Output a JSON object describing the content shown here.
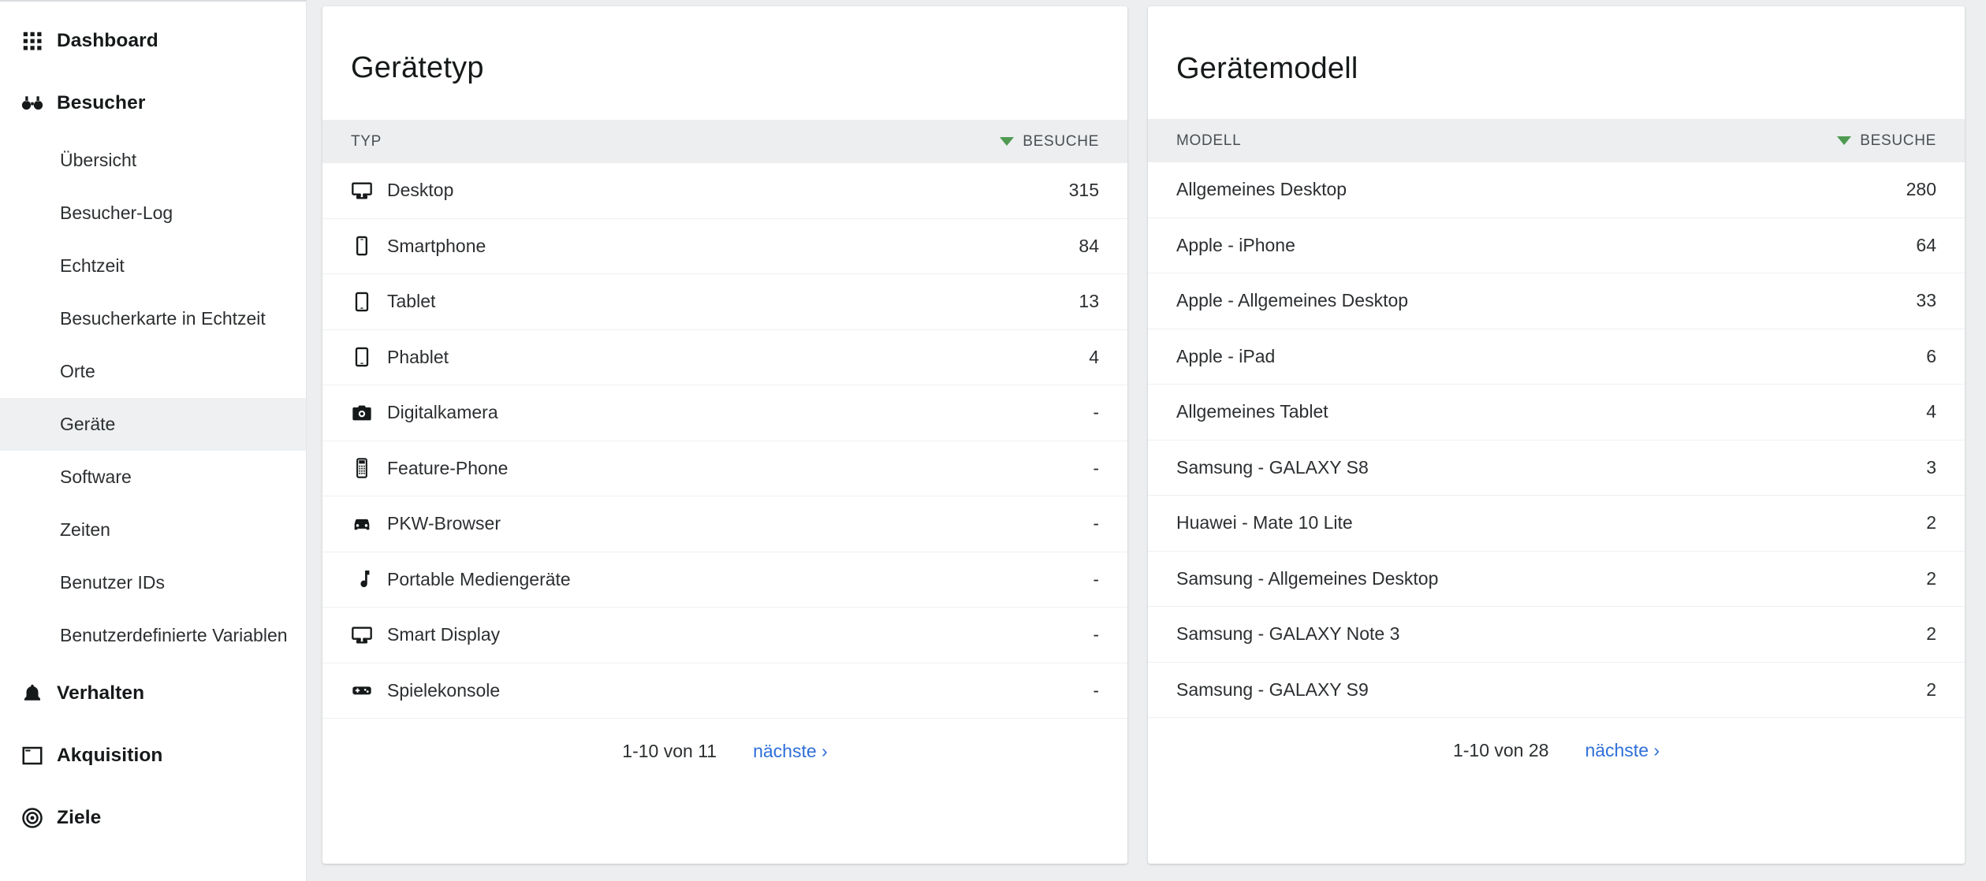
{
  "sidebar": {
    "groups": [
      {
        "icon": "grid-icon",
        "label": "Dashboard",
        "items": []
      },
      {
        "icon": "binoculars-icon",
        "label": "Besucher",
        "items": [
          {
            "label": "Übersicht",
            "active": false
          },
          {
            "label": "Besucher-Log",
            "active": false
          },
          {
            "label": "Echtzeit",
            "active": false
          },
          {
            "label": "Besucherkarte in Echtzeit",
            "active": false
          },
          {
            "label": "Orte",
            "active": false
          },
          {
            "label": "Geräte",
            "active": true
          },
          {
            "label": "Software",
            "active": false
          },
          {
            "label": "Zeiten",
            "active": false
          },
          {
            "label": "Benutzer IDs",
            "active": false
          },
          {
            "label": "Benutzerdefinierte Variablen",
            "active": false
          }
        ]
      },
      {
        "icon": "bell-icon",
        "label": "Verhalten",
        "items": []
      },
      {
        "icon": "window-icon",
        "label": "Akquisition",
        "items": []
      },
      {
        "icon": "target-icon",
        "label": "Ziele",
        "items": []
      }
    ]
  },
  "cards": [
    {
      "title": "Gerätetyp",
      "column_label": "TYP",
      "metric_label": "BESUCHE",
      "sort_direction": "desc",
      "sort_color": "#4e9a51",
      "rows": [
        {
          "icon": "desktop-icon",
          "label": "Desktop",
          "value": "315"
        },
        {
          "icon": "smartphone-icon",
          "label": "Smartphone",
          "value": "84"
        },
        {
          "icon": "tablet-icon",
          "label": "Tablet",
          "value": "13"
        },
        {
          "icon": "phablet-icon",
          "label": "Phablet",
          "value": "4"
        },
        {
          "icon": "camera-icon",
          "label": "Digitalkamera",
          "value": "-"
        },
        {
          "icon": "feature-phone-icon",
          "label": "Feature-Phone",
          "value": "-"
        },
        {
          "icon": "car-icon",
          "label": "PKW-Browser",
          "value": "-"
        },
        {
          "icon": "music-note-icon",
          "label": "Portable Mediengeräte",
          "value": "-"
        },
        {
          "icon": "smart-display-icon",
          "label": "Smart Display",
          "value": "-"
        },
        {
          "icon": "gamepad-icon",
          "label": "Spielekonsole",
          "value": "-"
        }
      ],
      "pager": {
        "range": "1-10 von 11",
        "next": "nächste ›"
      }
    },
    {
      "title": "Gerätemodell",
      "column_label": "MODELL",
      "metric_label": "BESUCHE",
      "sort_direction": "desc",
      "sort_color": "#4e9a51",
      "rows": [
        {
          "icon": "",
          "label": "Allgemeines Desktop",
          "value": "280"
        },
        {
          "icon": "",
          "label": "Apple - iPhone",
          "value": "64"
        },
        {
          "icon": "",
          "label": "Apple - Allgemeines Desktop",
          "value": "33"
        },
        {
          "icon": "",
          "label": "Apple - iPad",
          "value": "6"
        },
        {
          "icon": "",
          "label": "Allgemeines Tablet",
          "value": "4"
        },
        {
          "icon": "",
          "label": "Samsung - GALAXY S8",
          "value": "3"
        },
        {
          "icon": "",
          "label": "Huawei - Mate 10 Lite",
          "value": "2"
        },
        {
          "icon": "",
          "label": "Samsung - Allgemeines Desktop",
          "value": "2"
        },
        {
          "icon": "",
          "label": "Samsung - GALAXY Note 3",
          "value": "2"
        },
        {
          "icon": "",
          "label": "Samsung - GALAXY S9",
          "value": "2"
        }
      ],
      "pager": {
        "range": "1-10 von 28",
        "next": "nächste ›"
      }
    }
  ]
}
